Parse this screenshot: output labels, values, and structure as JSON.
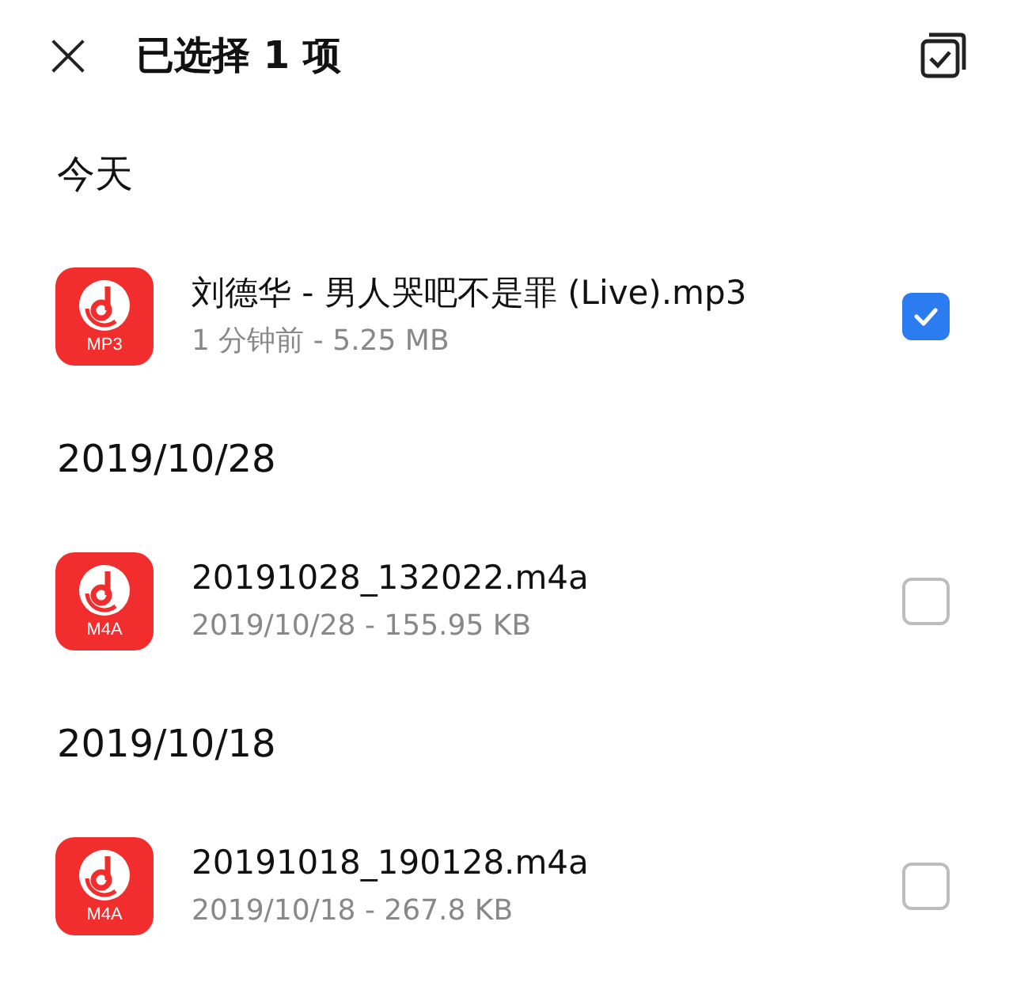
{
  "header": {
    "close": "×",
    "title": "已选择 1 项"
  },
  "sections": [
    {
      "label": "今天",
      "files": [
        {
          "name": "刘德华 - 男人哭吧不是罪 (Live).mp3",
          "meta": "1 分钟前 - 5.25 MB",
          "type": "MP3",
          "selected": true
        }
      ]
    },
    {
      "label": "2019/10/28",
      "files": [
        {
          "name": "20191028_132022.m4a",
          "meta": "2019/10/28 - 155.95 KB",
          "type": "M4A",
          "selected": false
        }
      ]
    },
    {
      "label": "2019/10/18",
      "files": [
        {
          "name": "20191018_190128.m4a",
          "meta": "2019/10/18 - 267.8 KB",
          "type": "M4A",
          "selected": false
        }
      ]
    }
  ]
}
